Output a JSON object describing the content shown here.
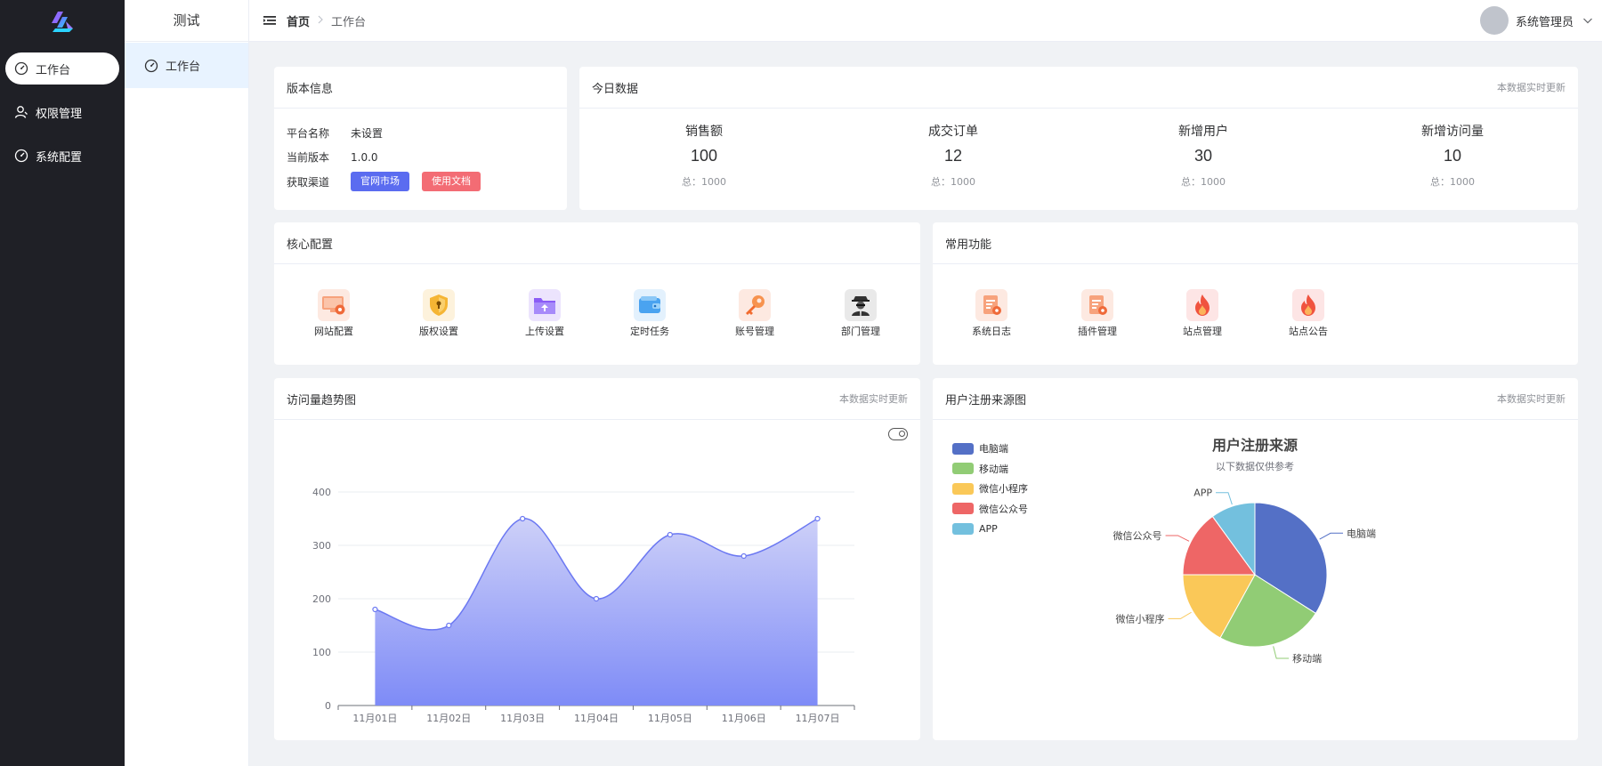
{
  "sidebar": {
    "items": [
      {
        "label": "工作台",
        "icon": "dashboard-icon"
      },
      {
        "label": "权限管理",
        "icon": "user-icon"
      },
      {
        "label": "系统配置",
        "icon": "dashboard-icon"
      }
    ]
  },
  "submenu": {
    "title": "测试",
    "item": "工作台"
  },
  "header": {
    "breadcrumb_home": "首页",
    "breadcrumb_current": "工作台",
    "user_name": "系统管理员"
  },
  "version_card": {
    "title": "版本信息",
    "rows": [
      {
        "key": "平台名称",
        "value": "未设置"
      },
      {
        "key": "当前版本",
        "value": "1.0.0"
      },
      {
        "key": "获取渠道"
      }
    ],
    "buttons": [
      "官网市场",
      "使用文档"
    ],
    "colors": {
      "primary": "#5b6cf0",
      "danger": "#f36c74"
    }
  },
  "today_card": {
    "title": "今日数据",
    "note": "本数据实时更新",
    "stats": [
      {
        "label": "销售额",
        "value": "100",
        "total": "总：1000"
      },
      {
        "label": "成交订单",
        "value": "12",
        "total": "总：1000"
      },
      {
        "label": "新增用户",
        "value": "30",
        "total": "总：1000"
      },
      {
        "label": "新增访问量",
        "value": "10",
        "total": "总：1000"
      }
    ]
  },
  "core_card": {
    "title": "核心配置",
    "items": [
      "网站配置",
      "版权设置",
      "上传设置",
      "定时任务",
      "账号管理",
      "部门管理"
    ]
  },
  "common_card": {
    "title": "常用功能",
    "items": [
      "系统日志",
      "插件管理",
      "站点管理",
      "站点公告"
    ]
  },
  "trend_card": {
    "title": "访问量趋势图",
    "note": "本数据实时更新"
  },
  "pie_card": {
    "title": "用户注册来源图",
    "note": "本数据实时更新"
  },
  "chart_data": [
    {
      "type": "area",
      "title": "",
      "xlabel": "",
      "ylabel": "",
      "categories": [
        "11月01日",
        "11月02日",
        "11月03日",
        "11月04日",
        "11月05日",
        "11月06日",
        "11月07日"
      ],
      "values": [
        180,
        150,
        350,
        200,
        320,
        280,
        350
      ],
      "ylim": [
        0,
        400
      ],
      "yticks": [
        0,
        100,
        200,
        300,
        400
      ],
      "grid": true,
      "smooth": true,
      "colors": {
        "line": "#6b78f2",
        "fill_top": "#cdd0f8",
        "fill_bottom": "#7e8bf7"
      }
    },
    {
      "type": "pie",
      "title": "用户注册来源",
      "subtitle": "以下数据仅供参考",
      "legend_position": "top-left",
      "series": [
        {
          "name": "电脑端",
          "value": 34,
          "color": "#5470c6"
        },
        {
          "name": "移动端",
          "value": 24,
          "color": "#91cc75"
        },
        {
          "name": "微信小程序",
          "value": 17,
          "color": "#fac858"
        },
        {
          "name": "微信公众号",
          "value": 15,
          "color": "#ee6666"
        },
        {
          "name": "APP",
          "value": 10,
          "color": "#73c0de"
        }
      ]
    }
  ]
}
